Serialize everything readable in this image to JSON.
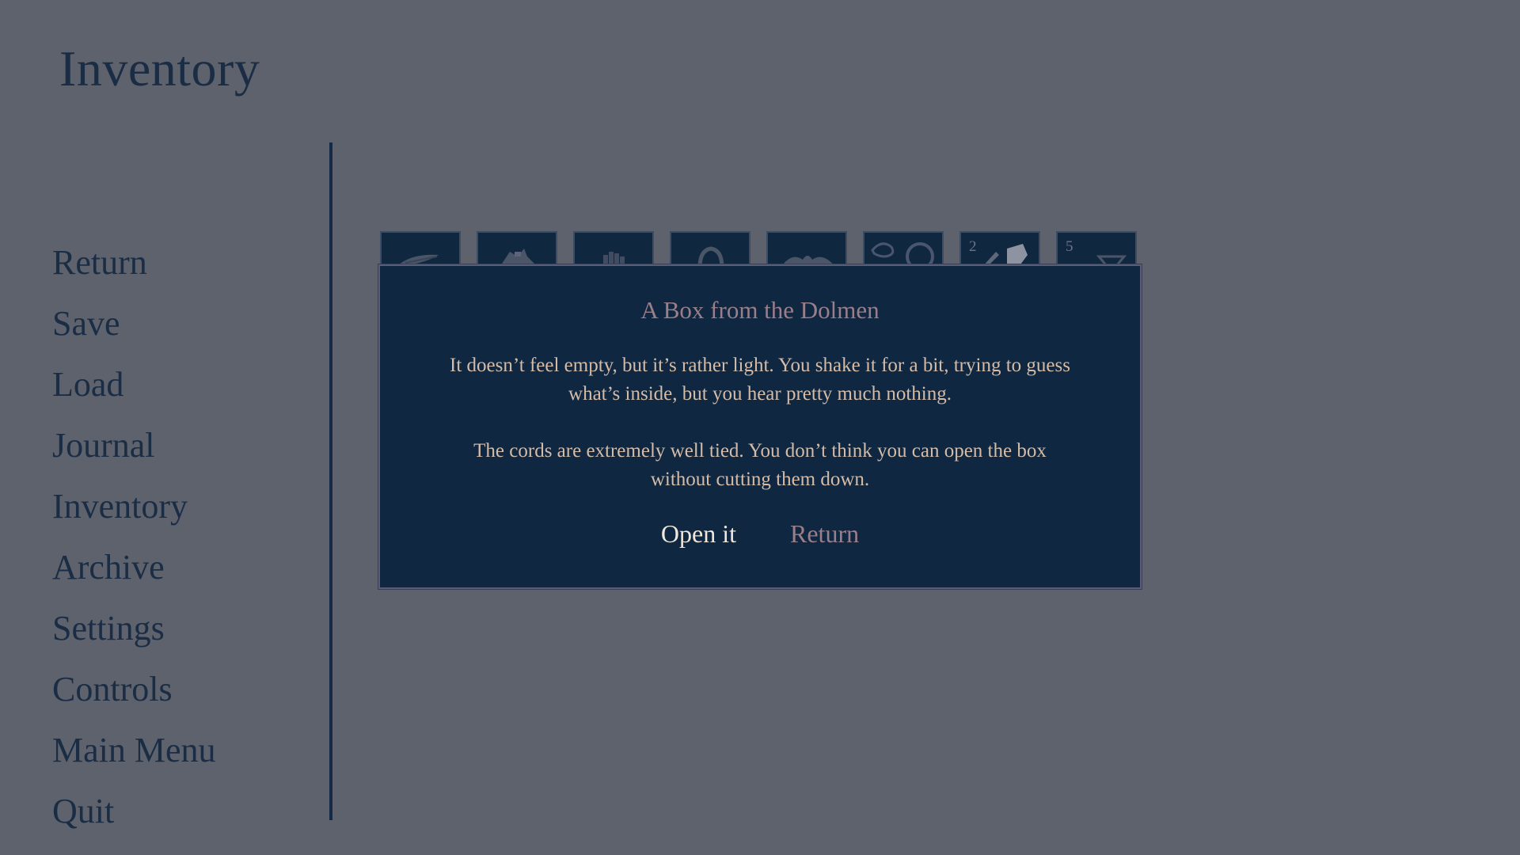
{
  "page": {
    "title": "Inventory"
  },
  "nav": {
    "items": [
      {
        "label": "Return"
      },
      {
        "label": "Save"
      },
      {
        "label": "Load"
      },
      {
        "label": "Journal"
      },
      {
        "label": "Inventory"
      },
      {
        "label": "Archive"
      },
      {
        "label": "Settings"
      },
      {
        "label": "Controls"
      },
      {
        "label": "Main Menu"
      },
      {
        "label": "Quit"
      }
    ]
  },
  "inventory": {
    "slots": [
      {
        "icon": "feather-icon",
        "count": ""
      },
      {
        "icon": "bird-icon",
        "count": ""
      },
      {
        "icon": "hand-icon",
        "count": ""
      },
      {
        "icon": "bell-icon",
        "count": ""
      },
      {
        "icon": "moustache-icon",
        "count": ""
      },
      {
        "icon": "rings-icon",
        "count": ""
      },
      {
        "icon": "knife-and-stone-icon",
        "count": "2"
      },
      {
        "icon": "gem-icon",
        "count": "5"
      }
    ]
  },
  "dialog": {
    "title": "A Box from the Dolmen",
    "para1_line1": "It doesn’t feel empty, but it’s rather light. You shake it for a bit, trying to guess",
    "para1_line2": "what’s inside, but you hear pretty much nothing.",
    "para2_line1": "The cords are extremely well tied. You don’t think you can open the box",
    "para2_line2": "without cutting them down.",
    "open_label": "Open it",
    "return_label": "Return"
  },
  "colors": {
    "background": "#5d626c",
    "panel": "#0f2740",
    "nav_text": "#1b2d45",
    "title_accent": "#9a7f8b",
    "body_text": "#d4bca8",
    "selected_button": "#f0e6da"
  }
}
